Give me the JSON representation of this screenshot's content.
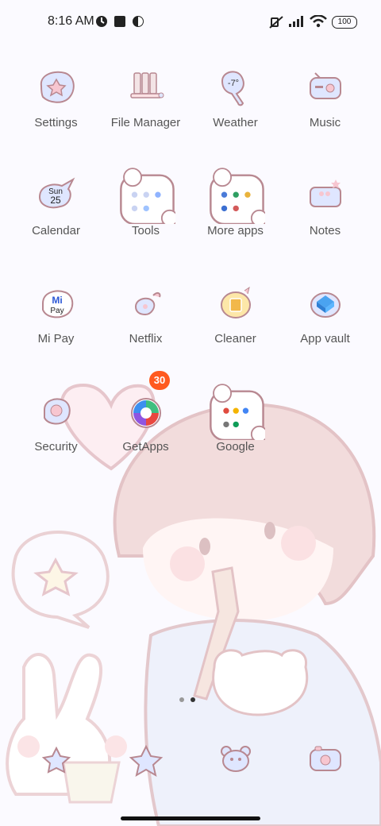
{
  "status_bar": {
    "time": "8:16 AM",
    "battery": "100",
    "icons": [
      "clock-icon",
      "stop-square-icon",
      "contrast-icon",
      "silent-icon",
      "signal-icon",
      "wifi-icon",
      "battery-icon"
    ]
  },
  "apps": [
    {
      "id": "settings",
      "label": "Settings",
      "icon": "settings-icon"
    },
    {
      "id": "file-manager",
      "label": "File Manager",
      "icon": "file-manager-icon"
    },
    {
      "id": "weather",
      "label": "Weather",
      "icon": "weather-icon",
      "icon_text": "-7°"
    },
    {
      "id": "music",
      "label": "Music",
      "icon": "music-icon"
    },
    {
      "id": "calendar",
      "label": "Calendar",
      "icon": "calendar-icon",
      "icon_day": "Sun",
      "icon_date": "25"
    },
    {
      "id": "tools",
      "label": "Tools",
      "icon": "folder-icon"
    },
    {
      "id": "more-apps",
      "label": "More apps",
      "icon": "folder-icon"
    },
    {
      "id": "notes",
      "label": "Notes",
      "icon": "notes-icon"
    },
    {
      "id": "mi-pay",
      "label": "Mi Pay",
      "icon": "mi-pay-icon",
      "icon_text_top": "Mi",
      "icon_text_bottom": "Pay"
    },
    {
      "id": "netflix",
      "label": "Netflix",
      "icon": "netflix-icon"
    },
    {
      "id": "cleaner",
      "label": "Cleaner",
      "icon": "cleaner-icon"
    },
    {
      "id": "app-vault",
      "label": "App vault",
      "icon": "app-vault-icon"
    },
    {
      "id": "security",
      "label": "Security",
      "icon": "security-icon"
    },
    {
      "id": "getapps",
      "label": "GetApps",
      "icon": "getapps-icon",
      "badge": "30"
    },
    {
      "id": "google",
      "label": "Google",
      "icon": "folder-icon"
    }
  ],
  "page_indicator": {
    "pages": 2,
    "current": 2
  },
  "dock": [
    {
      "id": "dock-1",
      "icon": "star-flower-icon"
    },
    {
      "id": "dock-2",
      "icon": "star-icon"
    },
    {
      "id": "dock-3",
      "icon": "bear-face-icon"
    },
    {
      "id": "dock-4",
      "icon": "camera-icon"
    }
  ],
  "colors": {
    "background": "#fbfaff",
    "icon_fill": "#dfe6ff",
    "icon_stroke": "#b88891",
    "badge": "#ff5a1f",
    "label": "#555555"
  }
}
